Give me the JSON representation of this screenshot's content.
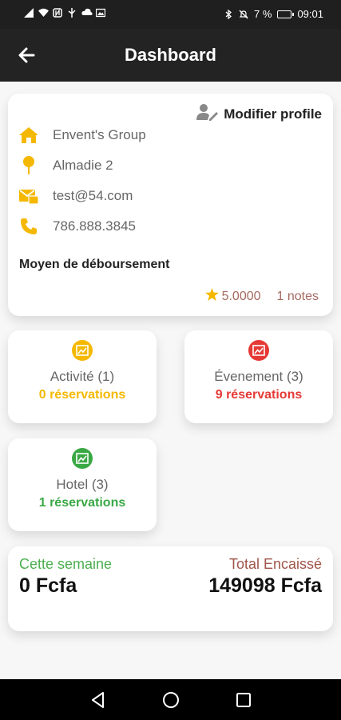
{
  "status_bar": {
    "battery": "7 %",
    "time": "09:01"
  },
  "app_bar": {
    "title": "Dashboard"
  },
  "profile": {
    "modify_label": "Modifier profile",
    "company": "Envent's Group",
    "location": "Almadie 2",
    "email": "test@54.com",
    "phone": "786.888.3845",
    "payout_label": "Moyen de déboursement",
    "rating": "5.0000",
    "notes": "1 notes"
  },
  "stats": [
    {
      "title": "Activité (1)",
      "reservations": "0 réservations",
      "color": "#f5b800"
    },
    {
      "title": "Évenement (3)",
      "reservations": "9 réservations",
      "color": "#e53935"
    },
    {
      "title": "Hotel (3)",
      "reservations": "1 réservations",
      "color": "#3aa845"
    }
  ],
  "totals": {
    "week_label": "Cette semaine",
    "week_value": "0 Fcfa",
    "total_label": "Total Encaissé",
    "total_value": "149098 Fcfa"
  },
  "colors": {
    "accent": "#f5b800",
    "week_label": "#4caf50",
    "total_label": "#a0554a"
  }
}
